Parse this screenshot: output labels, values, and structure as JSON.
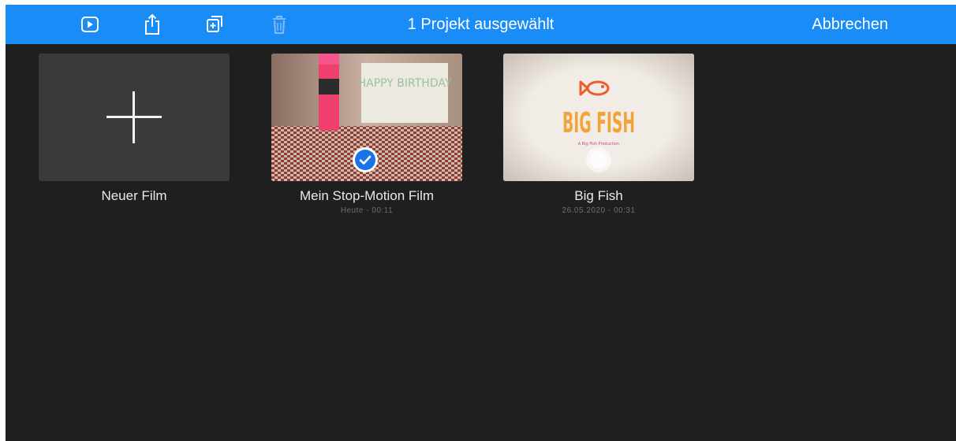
{
  "topbar": {
    "title": "1 Projekt ausgewählt",
    "cancel_label": "Abbrechen",
    "icons": [
      "play-icon",
      "share-icon",
      "duplicate-icon",
      "trash-icon"
    ]
  },
  "projects": [
    {
      "label": "Neuer Film",
      "subtitle": ""
    },
    {
      "label": "Mein Stop-Motion Film",
      "subtitle": "Heute - 00:11",
      "selected": true,
      "thumbnail_text": "HAPPY BIRTHDAY"
    },
    {
      "label": "Big Fish",
      "subtitle": "26.05.2020 - 00:31",
      "thumbnail_title": "BIG FISH",
      "thumbnail_tagline": "A Big Fish Production"
    }
  ],
  "colors": {
    "topbar": "#1a8cf7",
    "background": "#1f1f1f",
    "new_tile": "#3a3a3a",
    "check": "#1a73e8",
    "fish_title": "#f2a33a",
    "fish_logo": "#f05a28"
  }
}
